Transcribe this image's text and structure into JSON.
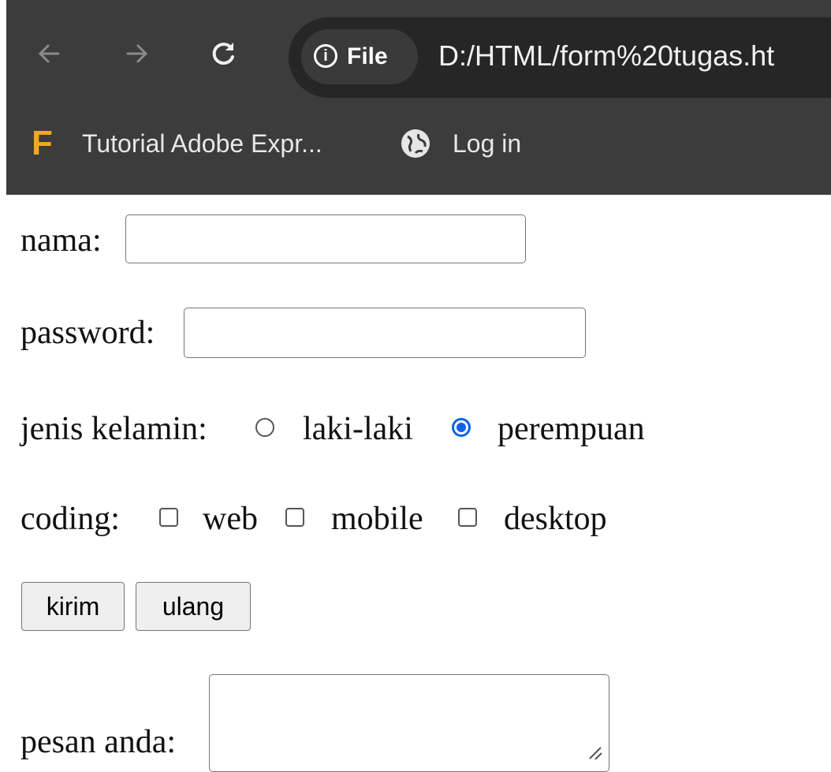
{
  "browser": {
    "back_icon": "arrow-left-icon",
    "forward_icon": "arrow-right-icon",
    "reload_icon": "reload-icon",
    "address": {
      "info_icon": "info-icon",
      "chip_label": "File",
      "url": "D:/HTML/form%20tugas.ht"
    },
    "bookmarks": [
      {
        "icon": "adobe-express-f-icon",
        "label": "Tutorial Adobe Expr..."
      },
      {
        "icon": "globe-icon",
        "label": "Log in"
      }
    ]
  },
  "form": {
    "nama": {
      "label": "nama:",
      "value": ""
    },
    "password": {
      "label": "password:",
      "value": ""
    },
    "gender": {
      "label": "jenis kelamin:",
      "options": [
        {
          "label": "laki-laki",
          "checked": false
        },
        {
          "label": "perempuan",
          "checked": true
        }
      ]
    },
    "coding": {
      "label": "coding:",
      "options": [
        {
          "label": "web",
          "checked": false
        },
        {
          "label": "mobile",
          "checked": false
        },
        {
          "label": "desktop",
          "checked": false
        }
      ]
    },
    "buttons": {
      "submit": "kirim",
      "reset": "ulang"
    },
    "message": {
      "label": "pesan anda:",
      "value": ""
    }
  },
  "colors": {
    "browser_bar": "#3c3c3c",
    "omnibox": "#262626",
    "radio_accent": "#0b63e5",
    "favicon_f": "#f2a91c"
  }
}
